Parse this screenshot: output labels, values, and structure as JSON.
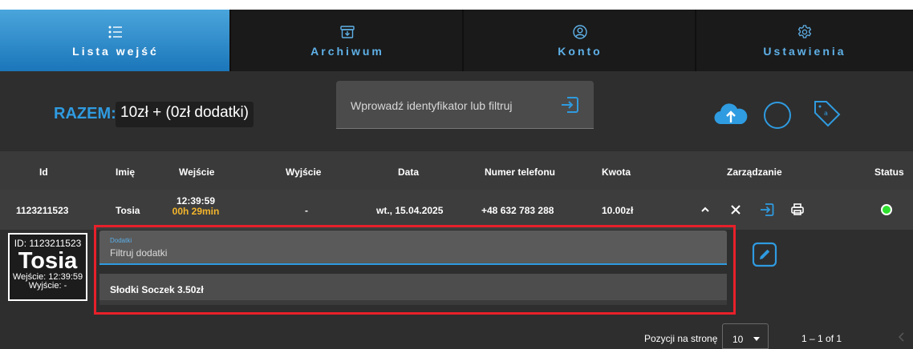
{
  "nav": {
    "tabs": [
      {
        "label": "Lista wejść",
        "icon": "list-icon",
        "active": true
      },
      {
        "label": "Archiwum",
        "icon": "archive-icon",
        "active": false
      },
      {
        "label": "Konto",
        "icon": "account-icon",
        "active": false
      },
      {
        "label": "Ustawienia",
        "icon": "gear-icon",
        "active": false
      }
    ]
  },
  "summary": {
    "razem_label": "RAZEM:",
    "total_value": "10zł + (0zł dodatki)",
    "search_placeholder": "Wprowadź identyfikator lub filtruj"
  },
  "table": {
    "headers": [
      "Id",
      "Imię",
      "Wejście",
      "Wyjście",
      "Data",
      "Numer telefonu",
      "Kwota",
      "Zarządzanie",
      "Status"
    ],
    "row": {
      "id": "1123211523",
      "name": "Tosia",
      "entry_time": "12:39:59",
      "entry_duration": "00h 29min",
      "exit": "-",
      "date": "wt., 15.04.2025",
      "phone": "+48 632 783 288",
      "amount": "10.00zł",
      "status_color": "#2ee02e"
    }
  },
  "detail": {
    "id_line": "ID: 1123211523",
    "name": "Tosia",
    "entry_line": "Wejście: 12:39:59",
    "exit_line": "Wyjście: -",
    "addon_label": "Dodatki",
    "addon_placeholder": "Filtruj dodatki",
    "addon_item": "Słodki Soczek 3.50zł"
  },
  "footer": {
    "per_page_label": "Pozycji na stronę",
    "per_page_value": "10",
    "range": "1 – 1 of 1"
  },
  "colors": {
    "accent": "#2f9be0",
    "highlight": "#e8202a",
    "duration": "#f3b52c"
  }
}
